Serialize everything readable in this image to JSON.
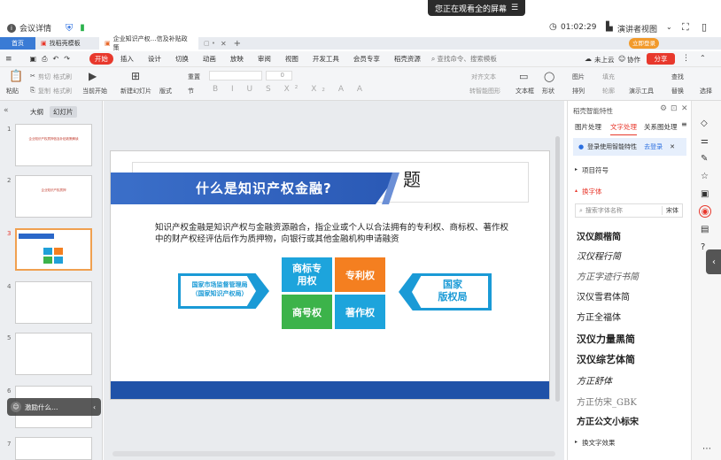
{
  "share_banner": "您正在观看全的屏幕",
  "meeting": {
    "info": "会议详情",
    "timer": "01:02:29",
    "presenter_view": "演讲者视图"
  },
  "tabs": [
    {
      "label": "首页"
    },
    {
      "label": "找稻壳模板"
    },
    {
      "label": "企业知识产权…信及补贴政策"
    }
  ],
  "login_btn": "立即登录",
  "menus": [
    "开始",
    "插入",
    "设计",
    "切换",
    "动画",
    "放映",
    "审阅",
    "视图",
    "开发工具",
    "会员专享",
    "稻壳资源"
  ],
  "search_placeholder": "查找命令、搜索模板",
  "top_right": {
    "cloud": "未上云",
    "collab": "协作",
    "share": "分享"
  },
  "toolbar": {
    "paste": "粘贴",
    "cut": "剪切",
    "copy": "复制",
    "format": "格式刷",
    "from_current": "当前开始",
    "new_slide": "新建幻灯片",
    "layout": "版式",
    "section": "节",
    "reset": "重置",
    "align_text": "对齐文本",
    "to_smartart": "转智能图形",
    "textbox": "文本框",
    "shape": "形状",
    "arrange": "排列",
    "image": "图片",
    "fill": "填充",
    "outline": "轮廓",
    "present": "演示工具",
    "find": "查找",
    "replace": "替换",
    "select": "选择",
    "font_size": "0"
  },
  "left_tabs": {
    "outline": "大纲",
    "slides": "幻灯片"
  },
  "slides": [
    {
      "num": "1",
      "title": "企业知识产权质押信及补贴政策解读"
    },
    {
      "num": "2",
      "title": "企业知识产权质押"
    },
    {
      "num": "3",
      "title": "什么是知识产权金融"
    },
    {
      "num": "4",
      "title": ""
    },
    {
      "num": "5",
      "title": ""
    },
    {
      "num": "6",
      "title": ""
    },
    {
      "num": "7",
      "title": ""
    }
  ],
  "toast": "激励什么…",
  "slide": {
    "title": "什么是知识产权金融?",
    "behind_title": "题",
    "body": "知识产权金融是知识产权与金融资源融合，指企业或个人以合法拥有的专利权、商标权、著作权中的财产权经评估后作为质押物，向银行或其他金融机构申请融资",
    "left_box": "国家市场监督管理局\n（国家知识产权局）",
    "right_box": "国家\n版权局",
    "tile1": "商标专\n用权",
    "tile2": "专利权",
    "tile3": "商号权",
    "tile4": "著作权"
  },
  "right_panel": {
    "header": "稻壳智能特性",
    "tabs": [
      "图片处理",
      "文字处理",
      "关系图处理"
    ],
    "login_hint": "登录使用智能特性",
    "login_link": "去登录",
    "section_bullets": "项目符号",
    "section_fonts": "换字体",
    "font_search": "搜索字体名称",
    "font_filter": "宋体",
    "fonts": [
      "汉仪颜楷简",
      "汉仪程行简",
      "方正字迹行书简",
      "汉仪雪君体简",
      "方正全福体",
      "汉仪力量黑简",
      "汉仪综艺体简",
      "方正舒体",
      "方正仿宋_GBK",
      "方正公文小标宋"
    ],
    "section_effects": "换文字效果"
  }
}
